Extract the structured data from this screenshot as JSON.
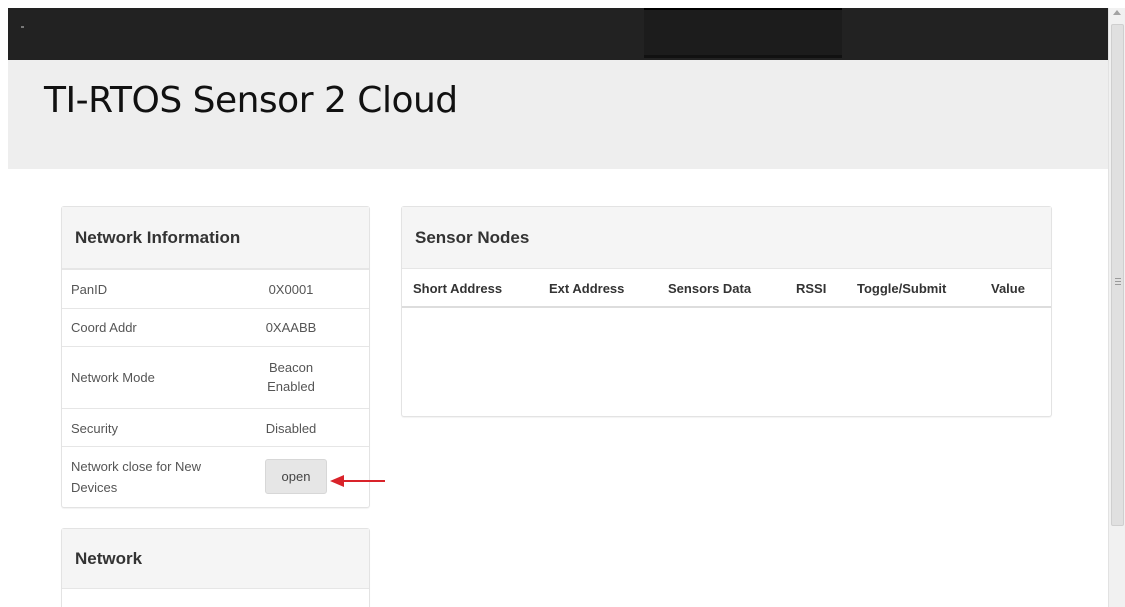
{
  "app": {
    "title": "TI-RTOS Sensor 2 Cloud"
  },
  "network_info": {
    "heading": "Network Information",
    "rows": [
      {
        "label": "PanID",
        "value": "0X0001"
      },
      {
        "label": "Coord Addr",
        "value": "0XAABB"
      },
      {
        "label": "Network Mode",
        "value_line1": "Beacon",
        "value_line2": "Enabled"
      },
      {
        "label": "Security",
        "value": "Disabled"
      }
    ],
    "join_row": {
      "label_line1": "Network close for New",
      "label_line2": "Devices",
      "button_label": "open"
    }
  },
  "network_panel": {
    "heading": "Network"
  },
  "sensor_nodes": {
    "heading": "Sensor Nodes",
    "columns": [
      "Short Address",
      "Ext Address",
      "Sensors Data",
      "RSSI",
      "Toggle/Submit",
      "Value"
    ],
    "rows": []
  },
  "colors": {
    "topbar": "#222222",
    "jumbotron": "#eeeeee",
    "annotation_arrow": "#d9232a"
  },
  "icons": {
    "annotation": "red-arrow-icon"
  }
}
